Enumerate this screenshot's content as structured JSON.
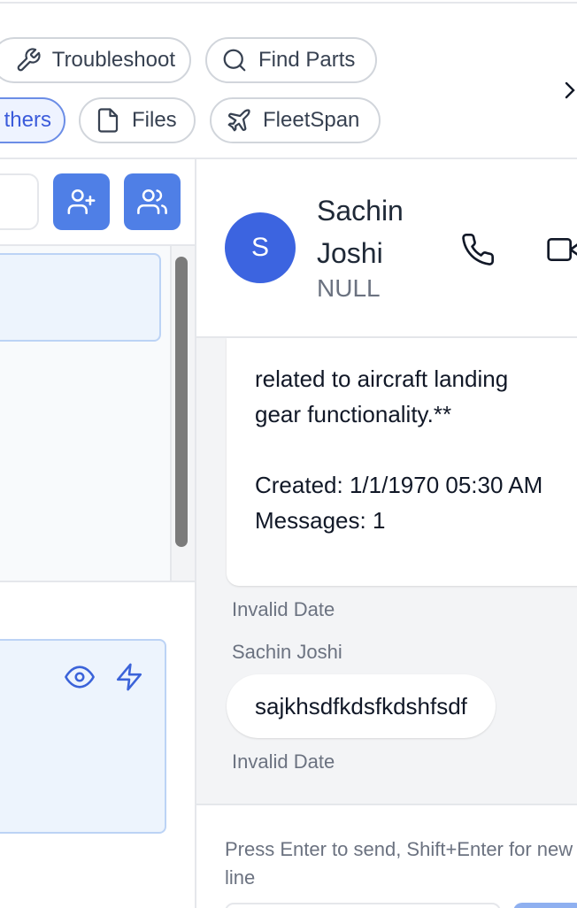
{
  "toolbar": {
    "row1": [
      {
        "label": "Troubleshoot",
        "icon": "wrench-icon"
      },
      {
        "label": "Find Parts",
        "icon": "search-icon"
      }
    ],
    "row2": [
      {
        "label": "Others",
        "visible_label": "thers",
        "active": true
      },
      {
        "label": "Files",
        "icon": "file-icon"
      },
      {
        "label": "FleetSpan",
        "icon": "plane-icon"
      }
    ]
  },
  "left_panel": {
    "add_user_icon": "user-plus-icon",
    "group_icon": "users-icon",
    "card_actions": [
      "eye-icon",
      "zap-icon"
    ]
  },
  "chat": {
    "contact": {
      "initial": "S",
      "name": "Sachin Joshi",
      "subtitle": "NULL"
    },
    "messages": [
      {
        "text": "related to aircraft landing gear functionality.**\n\nCreated: 1/1/1970 05:30 AM\nMessages: 1",
        "timestamp": "Invalid Date"
      },
      {
        "sender": "Sachin Joshi",
        "text": "sajkhsdfkdsfkdshfsdf",
        "timestamp": "Invalid Date"
      }
    ],
    "composer_hint": "Press Enter to send, Shift+Enter for new line"
  },
  "colors": {
    "accent": "#4f7fe6",
    "avatar": "#3c64e0",
    "active_chip_bg": "#eef3ff",
    "card_bg": "#edf4fd"
  }
}
